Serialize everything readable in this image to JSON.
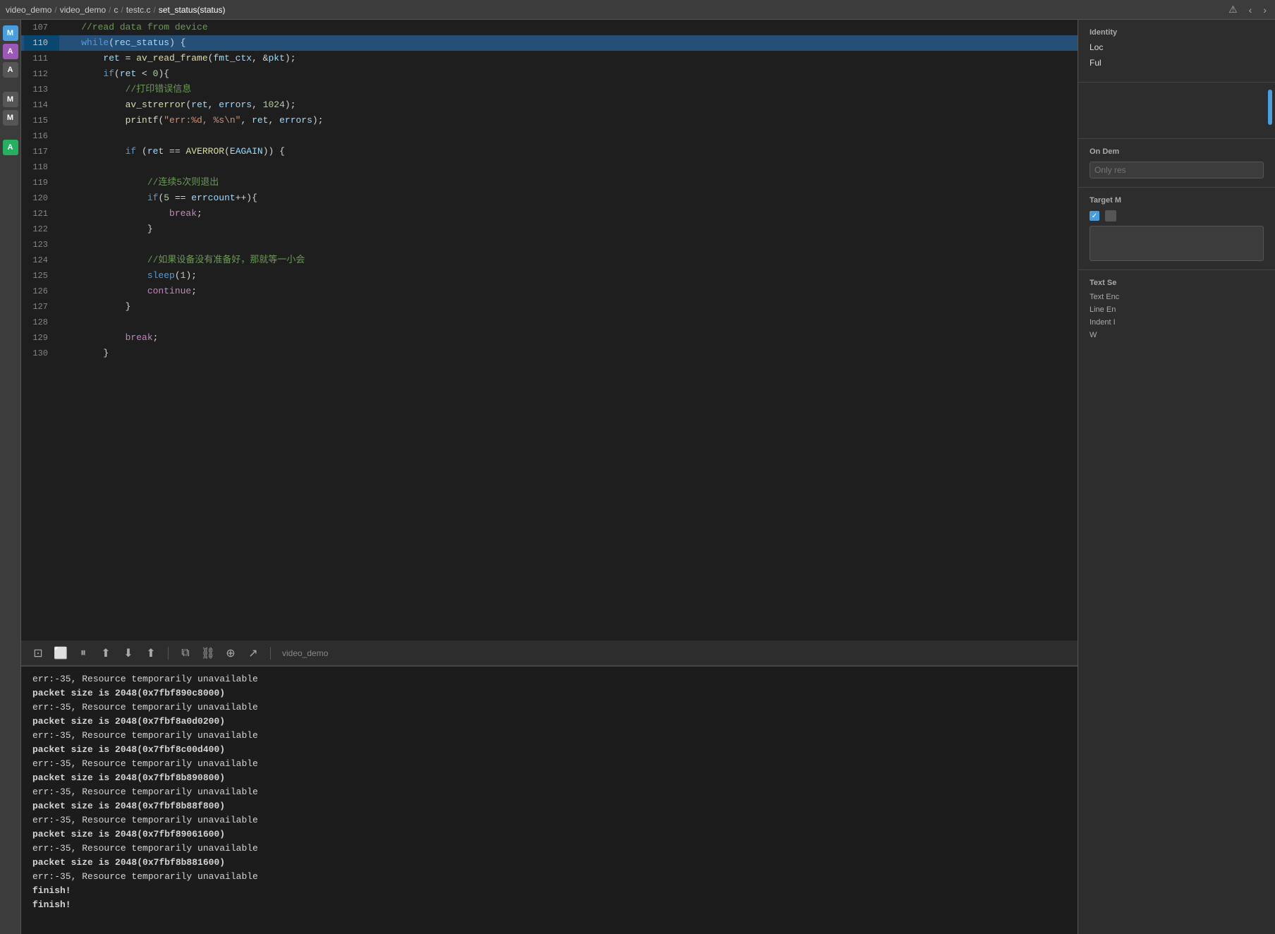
{
  "breadcrumb": {
    "parts": [
      "video_demo",
      "video_demo",
      "c",
      "testc.c",
      "set_status(status)"
    ],
    "separators": [
      "/",
      "/",
      "/",
      "/"
    ]
  },
  "editor": {
    "lines": [
      {
        "num": 107,
        "content": "    //read data from device",
        "type": "comment"
      },
      {
        "num": 110,
        "content": "    while(rec_status) {",
        "highlighted": true
      },
      {
        "num": 111,
        "content": "        ret = av_read_frame(fmt_ctx, &pkt);"
      },
      {
        "num": 112,
        "content": "        if(ret < 0){"
      },
      {
        "num": 113,
        "content": "            //打印错误信息",
        "type": "comment"
      },
      {
        "num": 114,
        "content": "            av_strerror(ret, errors, 1024);"
      },
      {
        "num": 115,
        "content": "            printf(\"err:%d, %s\\n\", ret, errors);"
      },
      {
        "num": 116,
        "content": ""
      },
      {
        "num": 117,
        "content": "            if (ret == AVERROR(EAGAIN)) {"
      },
      {
        "num": 118,
        "content": ""
      },
      {
        "num": 119,
        "content": "                //连续5次则退出",
        "type": "comment"
      },
      {
        "num": 120,
        "content": "                if(5 == errcount++){"
      },
      {
        "num": 121,
        "content": "                    break;"
      },
      {
        "num": 122,
        "content": "                }"
      },
      {
        "num": 123,
        "content": ""
      },
      {
        "num": 124,
        "content": "                //如果设备没有准备好，那就等一小会",
        "type": "comment"
      },
      {
        "num": 125,
        "content": "                sleep(1);"
      },
      {
        "num": 126,
        "content": "                continue;"
      },
      {
        "num": 127,
        "content": "            }"
      },
      {
        "num": 128,
        "content": ""
      },
      {
        "num": 129,
        "content": "            break;"
      },
      {
        "num": 130,
        "content": "        }"
      }
    ]
  },
  "terminal": {
    "project_name": "video_demo",
    "output_lines": [
      {
        "text": "err:-35, Resource temporarily unavailable",
        "bold": false
      },
      {
        "text": "packet size is 2048(0x7fbf890c8000)",
        "bold": true
      },
      {
        "text": "err:-35, Resource temporarily unavailable",
        "bold": false
      },
      {
        "text": "packet size is 2048(0x7fbf8a0d0200)",
        "bold": true
      },
      {
        "text": "err:-35, Resource temporarily unavailable",
        "bold": false
      },
      {
        "text": "packet size is 2048(0x7fbf8c00d400)",
        "bold": true
      },
      {
        "text": "err:-35, Resource temporarily unavailable",
        "bold": false
      },
      {
        "text": "packet size is 2048(0x7fbf8b890800)",
        "bold": true
      },
      {
        "text": "err:-35, Resource temporarily unavailable",
        "bold": false
      },
      {
        "text": "packet size is 2048(0x7fbf8b88f800)",
        "bold": true
      },
      {
        "text": "err:-35, Resource temporarily unavailable",
        "bold": false
      },
      {
        "text": "packet size is 2048(0x7fbf89061600)",
        "bold": true
      },
      {
        "text": "err:-35, Resource temporarily unavailable",
        "bold": false
      },
      {
        "text": "packet size is 2048(0x7fbf8b881600)",
        "bold": true
      },
      {
        "text": "err:-35, Resource temporarily unavailable",
        "bold": false
      },
      {
        "text": "finish!",
        "bold": true
      },
      {
        "text": "finish!",
        "bold": true
      }
    ]
  },
  "right_panel": {
    "identity_title": "Identity",
    "location_label": "Loc",
    "fullscreen_label": "Ful",
    "on_demand_title": "On Dem",
    "only_res_placeholder": "Only res",
    "target_title": "Target M",
    "checkbox_checked": true,
    "checkbox_label": "",
    "text_settings_title": "Text Se",
    "text_enc_label": "Text Enc",
    "line_end_label": "Line En",
    "indent_label": "Indent I",
    "wrap_label": "W"
  },
  "toolbar": {
    "buttons": [
      "⊡",
      "⬜",
      "⏸",
      "⬆",
      "⬇",
      "⬆",
      "⧉",
      "⛓",
      "⊕",
      "↗"
    ]
  }
}
